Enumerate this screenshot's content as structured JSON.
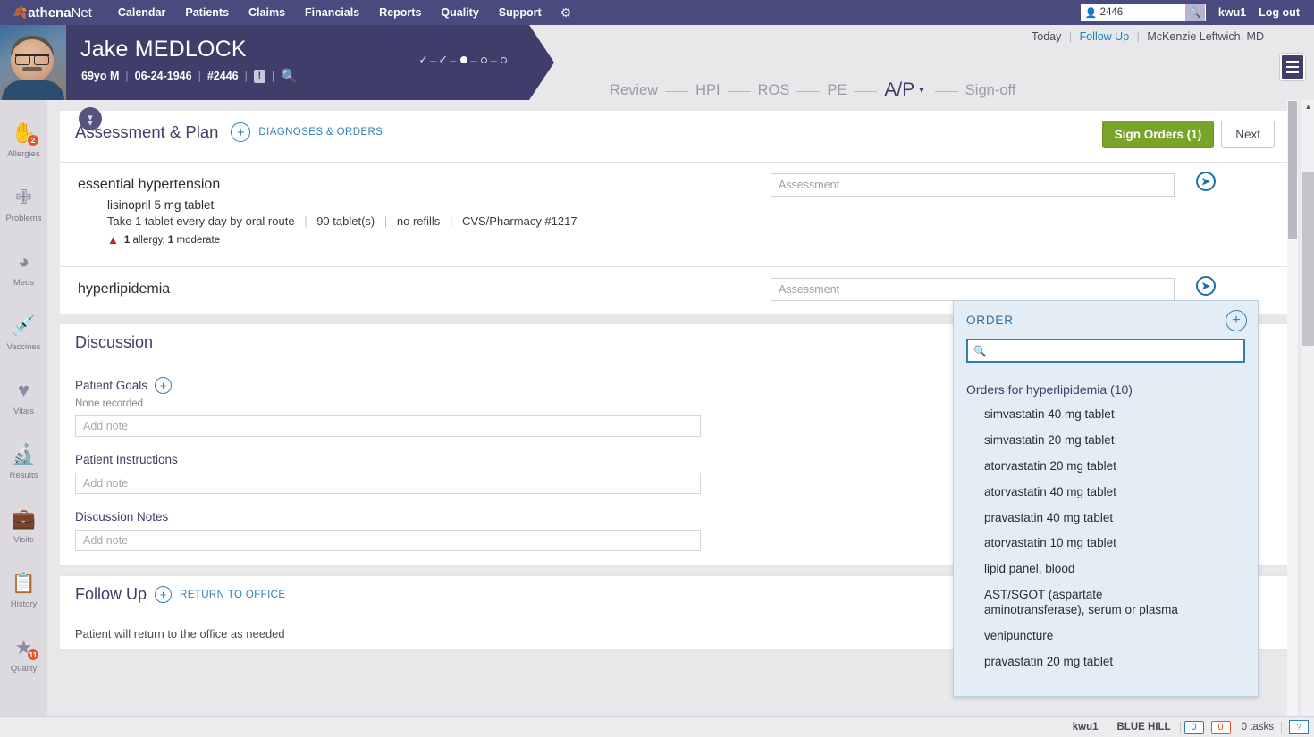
{
  "topnav": {
    "brand_prefix": "athena",
    "brand_suffix": "Net",
    "items": [
      "Calendar",
      "Patients",
      "Claims",
      "Financials",
      "Reports",
      "Quality",
      "Support"
    ],
    "gear_icon": "gear-icon",
    "search_value": "2446",
    "search_placeholder": "",
    "user": "kwu1",
    "logout": "Log out"
  },
  "patient": {
    "first_name": "Jake",
    "last_name": "MEDLOCK",
    "age_sex": "69yo M",
    "dob": "06-24-1946",
    "chart_id": "#2446",
    "alert_glyph": "!",
    "search_icon": "search-icon",
    "expand_icon": "chevron-double-down-icon"
  },
  "encounter": {
    "today": "Today",
    "type": "Follow Up",
    "provider": "McKenzie Leftwich, MD",
    "menu_icon": "hamburger-menu-icon"
  },
  "stepnav": {
    "steps": [
      "Review",
      "HPI",
      "ROS",
      "PE"
    ],
    "active": "A/P",
    "caret": "▾",
    "last": "Sign-off"
  },
  "sidebar": {
    "items": [
      {
        "label": "Allergies",
        "icon": "allergies-hand-icon",
        "glyph": "✋",
        "badge": "2"
      },
      {
        "label": "Problems",
        "icon": "problems-bandage-icon",
        "glyph": "✙",
        "badge": ""
      },
      {
        "label": "Meds",
        "icon": "meds-capsule-icon",
        "glyph": "◑",
        "badge": ""
      },
      {
        "label": "Vaccines",
        "icon": "vaccines-syringe-icon",
        "glyph": "⚗",
        "badge": ""
      },
      {
        "label": "Vitals",
        "icon": "vitals-heart-icon",
        "glyph": "♥",
        "badge": ""
      },
      {
        "label": "Results",
        "icon": "results-flask-icon",
        "glyph": "⚗",
        "badge": ""
      },
      {
        "label": "Visits",
        "icon": "visits-bag-icon",
        "glyph": "⚒",
        "badge": ""
      },
      {
        "label": "History",
        "icon": "history-clipboard-icon",
        "glyph": "☷",
        "badge": ""
      },
      {
        "label": "Quality",
        "icon": "quality-star-icon",
        "glyph": "★",
        "badge": "11"
      }
    ]
  },
  "assessment_plan": {
    "title": "Assessment & Plan",
    "add_link": "DIAGNOSES & ORDERS",
    "sign_orders_label": "Sign Orders (1)",
    "next_label": "Next",
    "diagnoses": [
      {
        "name": "essential hypertension",
        "assessment_placeholder": "Assessment",
        "assessment_value": "",
        "medication": {
          "name": "lisinopril 5 mg tablet",
          "sig": "Take 1 tablet every day by oral route",
          "quantity": "90 tablet(s)",
          "refills": "no refills",
          "pharmacy": "CVS/Pharmacy #1217",
          "warning_count": "1",
          "warning_label_1": "allergy,",
          "warning_count_2": "1",
          "warning_label_2": "moderate"
        }
      },
      {
        "name": "hyperlipidemia",
        "assessment_placeholder": "Assessment",
        "assessment_value": ""
      }
    ]
  },
  "order_popover": {
    "title": "ORDER",
    "add_icon": "plus-circle-icon",
    "search_icon": "search-icon",
    "search_value": "",
    "search_placeholder": "",
    "group_label": "Orders for hyperlipidemia (10)",
    "items": [
      "simvastatin 40 mg tablet",
      "simvastatin 20 mg tablet",
      "atorvastatin 20 mg tablet",
      "atorvastatin 40 mg tablet",
      "pravastatin 40 mg tablet",
      "atorvastatin 10 mg tablet",
      "lipid panel, blood",
      "AST/SGOT (aspartate aminotransferase), serum or plasma",
      "venipuncture",
      "pravastatin 20 mg tablet"
    ]
  },
  "discussion": {
    "title": "Discussion",
    "patient_goals_label": "Patient Goals",
    "patient_goals_none": "None recorded",
    "patient_goals_placeholder": "Add note",
    "patient_goals_value": "",
    "patient_instructions_label": "Patient Instructions",
    "patient_instructions_placeholder": "Add note",
    "patient_instructions_value": "",
    "discussion_notes_label": "Discussion Notes",
    "discussion_notes_placeholder": "Add note",
    "discussion_notes_value": ""
  },
  "follow_up": {
    "title": "Follow Up",
    "add_link": "RETURN TO OFFICE",
    "text": "Patient will return to the office as needed"
  },
  "statusbar": {
    "user": "kwu1",
    "practice": "BLUE HILL",
    "count_blue": "0",
    "count_orange": "0",
    "tasks": "0 tasks",
    "help": "?"
  },
  "colors": {
    "nav_purple": "#494b7e",
    "banner_purple": "#3f3d69",
    "accent_blue": "#2f7fb5",
    "sign_green": "#7aa32a",
    "badge_orange": "#e0592a",
    "popover_blue": "#e3edf5"
  }
}
